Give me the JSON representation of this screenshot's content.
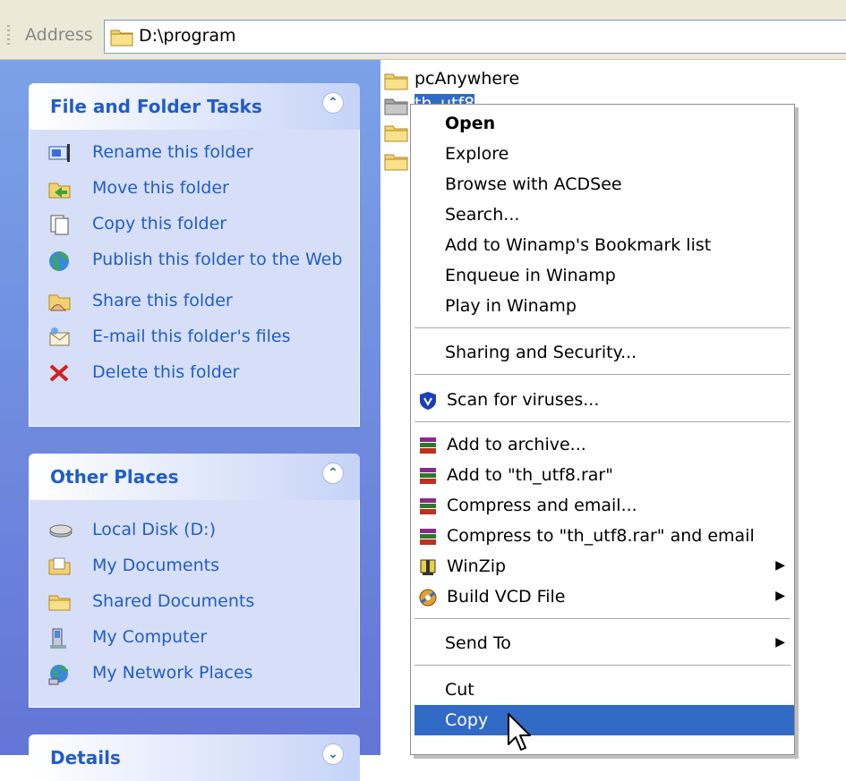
{
  "address": {
    "label": "Address",
    "value": "D:\\program"
  },
  "task_pane": {
    "file_folder_tasks": {
      "title": "File and Folder Tasks",
      "items": [
        {
          "label": "Rename this folder",
          "icon": "rename-icon"
        },
        {
          "label": "Move this folder",
          "icon": "move-icon"
        },
        {
          "label": "Copy this folder",
          "icon": "copy-icon"
        },
        {
          "label": "Publish this folder to the Web",
          "icon": "publish-web-icon"
        },
        {
          "label": "Share this folder",
          "icon": "share-icon"
        },
        {
          "label": "E-mail this folder's files",
          "icon": "email-icon"
        },
        {
          "label": "Delete this folder",
          "icon": "delete-icon"
        }
      ]
    },
    "other_places": {
      "title": "Other Places",
      "items": [
        {
          "label": "Local Disk (D:)",
          "icon": "disk-icon"
        },
        {
          "label": "My Documents",
          "icon": "my-documents-icon"
        },
        {
          "label": "Shared Documents",
          "icon": "folder-icon"
        },
        {
          "label": "My Computer",
          "icon": "computer-icon"
        },
        {
          "label": "My Network Places",
          "icon": "network-icon"
        }
      ]
    },
    "details": {
      "title": "Details"
    }
  },
  "files": [
    {
      "name": "pcAnywhere"
    },
    {
      "name": "th_utf8",
      "selected": true
    }
  ],
  "context_menu": {
    "groups": [
      [
        {
          "label": "Open",
          "bold": true
        },
        {
          "label": "Explore"
        },
        {
          "label": "Browse with ACDSee"
        },
        {
          "label": "Search..."
        },
        {
          "label": "Add to Winamp's Bookmark list"
        },
        {
          "label": "Enqueue in Winamp"
        },
        {
          "label": "Play in Winamp"
        }
      ],
      [
        {
          "label": "Sharing and Security..."
        }
      ],
      [
        {
          "label": "Scan for viruses...",
          "icon": "shield-icon"
        }
      ],
      [
        {
          "label": "Add to archive...",
          "icon": "winrar-icon"
        },
        {
          "label": "Add to \"th_utf8.rar\"",
          "icon": "winrar-icon"
        },
        {
          "label": "Compress and email...",
          "icon": "winrar-icon"
        },
        {
          "label": "Compress to \"th_utf8.rar\" and email",
          "icon": "winrar-icon"
        },
        {
          "label": "WinZip",
          "icon": "winzip-icon",
          "submenu": true
        },
        {
          "label": "Build VCD File",
          "icon": "vcd-icon",
          "submenu": true
        }
      ],
      [
        {
          "label": "Send To",
          "submenu": true
        }
      ],
      [
        {
          "label": "Cut"
        },
        {
          "label": "Copy",
          "highlighted": true
        }
      ]
    ]
  },
  "colors": {
    "task_link": "#215dc6",
    "pane_bg": "#6375d6",
    "highlight": "#316ac5"
  }
}
